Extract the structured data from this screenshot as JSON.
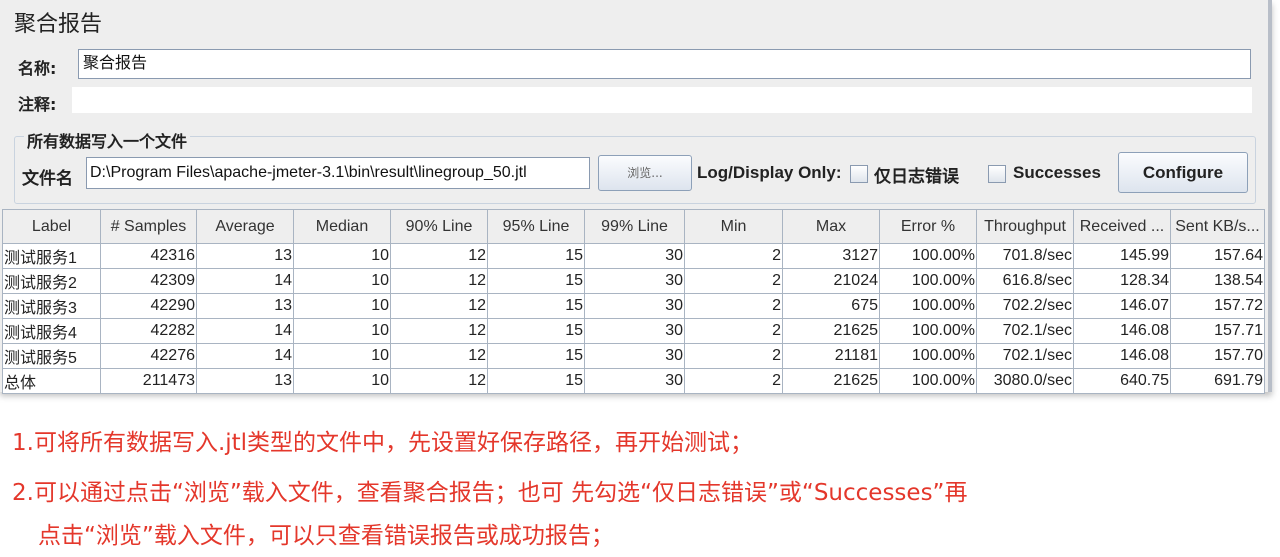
{
  "title": "聚合报告",
  "name_label": "名称:",
  "name_value": "聚合报告",
  "comment_label": "注释:",
  "comment_value": "",
  "group_title": "所有数据写入一个文件",
  "file_label": "文件名",
  "file_value": "D:\\Program Files\\apache-jmeter-3.1\\bin\\result\\linegroup_50.jtl",
  "browse_label": "浏览...",
  "log_label": "Log/Display Only:",
  "errors_label": "仅日志错误",
  "successes_label": "Successes",
  "configure_label": "Configure",
  "table": {
    "headers": [
      "Label",
      "# Samples",
      "Average",
      "Median",
      "90% Line",
      "95% Line",
      "99% Line",
      "Min",
      "Max",
      "Error %",
      "Throughput",
      "Received ...",
      "Sent KB/s..."
    ],
    "rows": [
      [
        "测试服务1",
        "42316",
        "13",
        "10",
        "12",
        "15",
        "30",
        "2",
        "3127",
        "100.00%",
        "701.8/sec",
        "145.99",
        "157.64"
      ],
      [
        "测试服务2",
        "42309",
        "14",
        "10",
        "12",
        "15",
        "30",
        "2",
        "21024",
        "100.00%",
        "616.8/sec",
        "128.34",
        "138.54"
      ],
      [
        "测试服务3",
        "42290",
        "13",
        "10",
        "12",
        "15",
        "30",
        "2",
        "675",
        "100.00%",
        "702.2/sec",
        "146.07",
        "157.72"
      ],
      [
        "测试服务4",
        "42282",
        "14",
        "10",
        "12",
        "15",
        "30",
        "2",
        "21625",
        "100.00%",
        "702.1/sec",
        "146.08",
        "157.71"
      ],
      [
        "测试服务5",
        "42276",
        "14",
        "10",
        "12",
        "15",
        "30",
        "2",
        "21181",
        "100.00%",
        "702.1/sec",
        "146.08",
        "157.70"
      ],
      [
        "总体",
        "211473",
        "13",
        "10",
        "12",
        "15",
        "30",
        "2",
        "21625",
        "100.00%",
        "3080.0/sec",
        "640.75",
        "691.79"
      ]
    ]
  },
  "notes": [
    "1.可将所有数据写入.jtl类型的文件中，先设置好保存路径，再开始测试；",
    "2.可以通过点击“浏览”载入文件，查看聚合报告；也可 先勾选“仅日志错误”或“Successes”再",
    "点击“浏览”载入文件，可以只查看错误报告或成功报告；"
  ]
}
